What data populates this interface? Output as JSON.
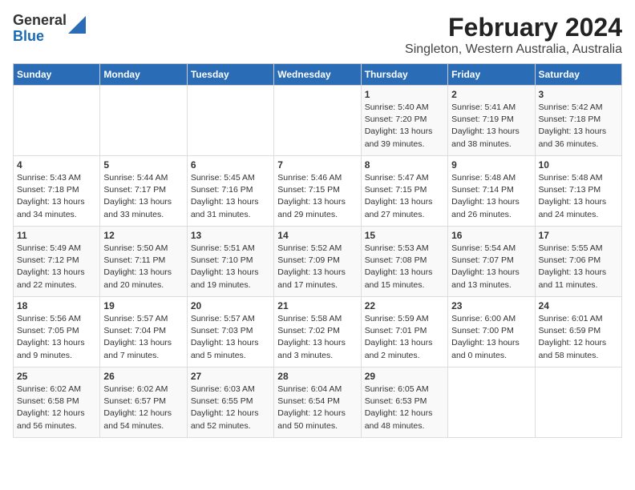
{
  "logo": {
    "line1": "General",
    "line2": "Blue"
  },
  "title": "February 2024",
  "subtitle": "Singleton, Western Australia, Australia",
  "days_of_week": [
    "Sunday",
    "Monday",
    "Tuesday",
    "Wednesday",
    "Thursday",
    "Friday",
    "Saturday"
  ],
  "weeks": [
    [
      {
        "day": "",
        "info": ""
      },
      {
        "day": "",
        "info": ""
      },
      {
        "day": "",
        "info": ""
      },
      {
        "day": "",
        "info": ""
      },
      {
        "day": "1",
        "info": "Sunrise: 5:40 AM\nSunset: 7:20 PM\nDaylight: 13 hours\nand 39 minutes."
      },
      {
        "day": "2",
        "info": "Sunrise: 5:41 AM\nSunset: 7:19 PM\nDaylight: 13 hours\nand 38 minutes."
      },
      {
        "day": "3",
        "info": "Sunrise: 5:42 AM\nSunset: 7:18 PM\nDaylight: 13 hours\nand 36 minutes."
      }
    ],
    [
      {
        "day": "4",
        "info": "Sunrise: 5:43 AM\nSunset: 7:18 PM\nDaylight: 13 hours\nand 34 minutes."
      },
      {
        "day": "5",
        "info": "Sunrise: 5:44 AM\nSunset: 7:17 PM\nDaylight: 13 hours\nand 33 minutes."
      },
      {
        "day": "6",
        "info": "Sunrise: 5:45 AM\nSunset: 7:16 PM\nDaylight: 13 hours\nand 31 minutes."
      },
      {
        "day": "7",
        "info": "Sunrise: 5:46 AM\nSunset: 7:15 PM\nDaylight: 13 hours\nand 29 minutes."
      },
      {
        "day": "8",
        "info": "Sunrise: 5:47 AM\nSunset: 7:15 PM\nDaylight: 13 hours\nand 27 minutes."
      },
      {
        "day": "9",
        "info": "Sunrise: 5:48 AM\nSunset: 7:14 PM\nDaylight: 13 hours\nand 26 minutes."
      },
      {
        "day": "10",
        "info": "Sunrise: 5:48 AM\nSunset: 7:13 PM\nDaylight: 13 hours\nand 24 minutes."
      }
    ],
    [
      {
        "day": "11",
        "info": "Sunrise: 5:49 AM\nSunset: 7:12 PM\nDaylight: 13 hours\nand 22 minutes."
      },
      {
        "day": "12",
        "info": "Sunrise: 5:50 AM\nSunset: 7:11 PM\nDaylight: 13 hours\nand 20 minutes."
      },
      {
        "day": "13",
        "info": "Sunrise: 5:51 AM\nSunset: 7:10 PM\nDaylight: 13 hours\nand 19 minutes."
      },
      {
        "day": "14",
        "info": "Sunrise: 5:52 AM\nSunset: 7:09 PM\nDaylight: 13 hours\nand 17 minutes."
      },
      {
        "day": "15",
        "info": "Sunrise: 5:53 AM\nSunset: 7:08 PM\nDaylight: 13 hours\nand 15 minutes."
      },
      {
        "day": "16",
        "info": "Sunrise: 5:54 AM\nSunset: 7:07 PM\nDaylight: 13 hours\nand 13 minutes."
      },
      {
        "day": "17",
        "info": "Sunrise: 5:55 AM\nSunset: 7:06 PM\nDaylight: 13 hours\nand 11 minutes."
      }
    ],
    [
      {
        "day": "18",
        "info": "Sunrise: 5:56 AM\nSunset: 7:05 PM\nDaylight: 13 hours\nand 9 minutes."
      },
      {
        "day": "19",
        "info": "Sunrise: 5:57 AM\nSunset: 7:04 PM\nDaylight: 13 hours\nand 7 minutes."
      },
      {
        "day": "20",
        "info": "Sunrise: 5:57 AM\nSunset: 7:03 PM\nDaylight: 13 hours\nand 5 minutes."
      },
      {
        "day": "21",
        "info": "Sunrise: 5:58 AM\nSunset: 7:02 PM\nDaylight: 13 hours\nand 3 minutes."
      },
      {
        "day": "22",
        "info": "Sunrise: 5:59 AM\nSunset: 7:01 PM\nDaylight: 13 hours\nand 2 minutes."
      },
      {
        "day": "23",
        "info": "Sunrise: 6:00 AM\nSunset: 7:00 PM\nDaylight: 13 hours\nand 0 minutes."
      },
      {
        "day": "24",
        "info": "Sunrise: 6:01 AM\nSunset: 6:59 PM\nDaylight: 12 hours\nand 58 minutes."
      }
    ],
    [
      {
        "day": "25",
        "info": "Sunrise: 6:02 AM\nSunset: 6:58 PM\nDaylight: 12 hours\nand 56 minutes."
      },
      {
        "day": "26",
        "info": "Sunrise: 6:02 AM\nSunset: 6:57 PM\nDaylight: 12 hours\nand 54 minutes."
      },
      {
        "day": "27",
        "info": "Sunrise: 6:03 AM\nSunset: 6:55 PM\nDaylight: 12 hours\nand 52 minutes."
      },
      {
        "day": "28",
        "info": "Sunrise: 6:04 AM\nSunset: 6:54 PM\nDaylight: 12 hours\nand 50 minutes."
      },
      {
        "day": "29",
        "info": "Sunrise: 6:05 AM\nSunset: 6:53 PM\nDaylight: 12 hours\nand 48 minutes."
      },
      {
        "day": "",
        "info": ""
      },
      {
        "day": "",
        "info": ""
      }
    ]
  ]
}
